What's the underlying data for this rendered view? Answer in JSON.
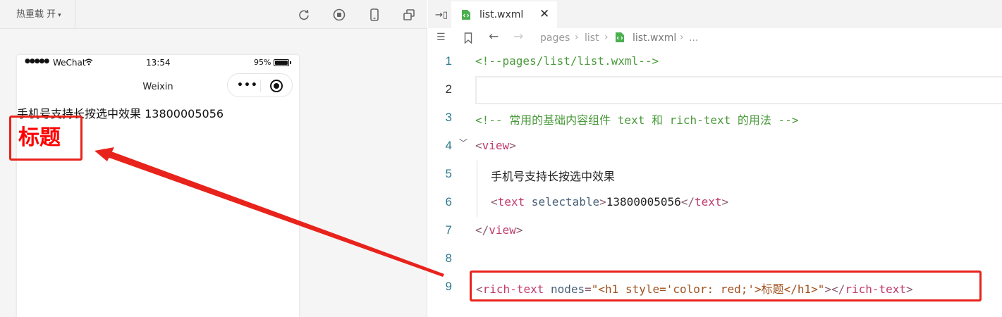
{
  "simulator": {
    "toolbar": {
      "hot_reload_label": "热重载 开",
      "icons": [
        "refresh-icon",
        "stop-icon",
        "phone-icon",
        "new-window-icon"
      ]
    },
    "status_bar": {
      "signal": "●●●●●",
      "carrier": "WeChat",
      "time": "13:54",
      "battery": "95%"
    },
    "nav_title": "Weixin",
    "content": {
      "line1": "手机号支持长按选中效果 13800005056",
      "rich_text_h1": "标题"
    }
  },
  "editor": {
    "tab": {
      "label": "list.wxml",
      "close": "✕"
    },
    "breadcrumb": [
      "pages",
      "list",
      "list.wxml",
      "..."
    ],
    "lines": [
      {
        "n": "1",
        "text": "<!--pages/list/list.wxml-->"
      },
      {
        "n": "2",
        "text": ""
      },
      {
        "n": "3",
        "text": "<!-- 常用的基础内容组件 text 和 rich-text 的用法 -->"
      },
      {
        "n": "4",
        "text": "<view>"
      },
      {
        "n": "5",
        "text": "手机号支持长按选中效果"
      },
      {
        "n": "6",
        "text": "<text selectable>13800005056</text>"
      },
      {
        "n": "7",
        "text": "</view>"
      },
      {
        "n": "8",
        "text": ""
      },
      {
        "n": "9",
        "text": "<rich-text nodes=\"<h1 style='color: red;'>标题</h1>\"></rich-text>"
      }
    ],
    "tokens": {
      "l1": "<!--pages/list/list.wxml-->",
      "l3": "<!-- 常用的基础内容组件 text 和 rich-text 的用法 -->",
      "l4_open": "<",
      "l4_tag": "view",
      "l4_close": ">",
      "l5": "手机号支持长按选中效果",
      "l6_open": "<",
      "l6_tag": "text",
      "l6_attr": " selectable",
      "l6_gt": ">",
      "l6_text": "13800005056",
      "l6_end_open": "</",
      "l6_end_tag": "text",
      "l6_end_close": ">",
      "l7_open": "</",
      "l7_tag": "view",
      "l7_close": ">",
      "l9_open": "<",
      "l9_tag": "rich-text",
      "l9_attr": " nodes",
      "l9_eq": "=",
      "l9_str1": "\"<h1 style='color: red;'>",
      "l9_str_text": "标题",
      "l9_str2": "</h1>\"",
      "l9_gt": ">",
      "l9_end_open": "</",
      "l9_end_tag": "rich-text",
      "l9_end_close": ">"
    }
  },
  "colors": {
    "annotation": "#e8231c",
    "rich_text_red": "#ff0000",
    "comment_green": "#4a9a3b",
    "tag_pink": "#c0396b"
  }
}
